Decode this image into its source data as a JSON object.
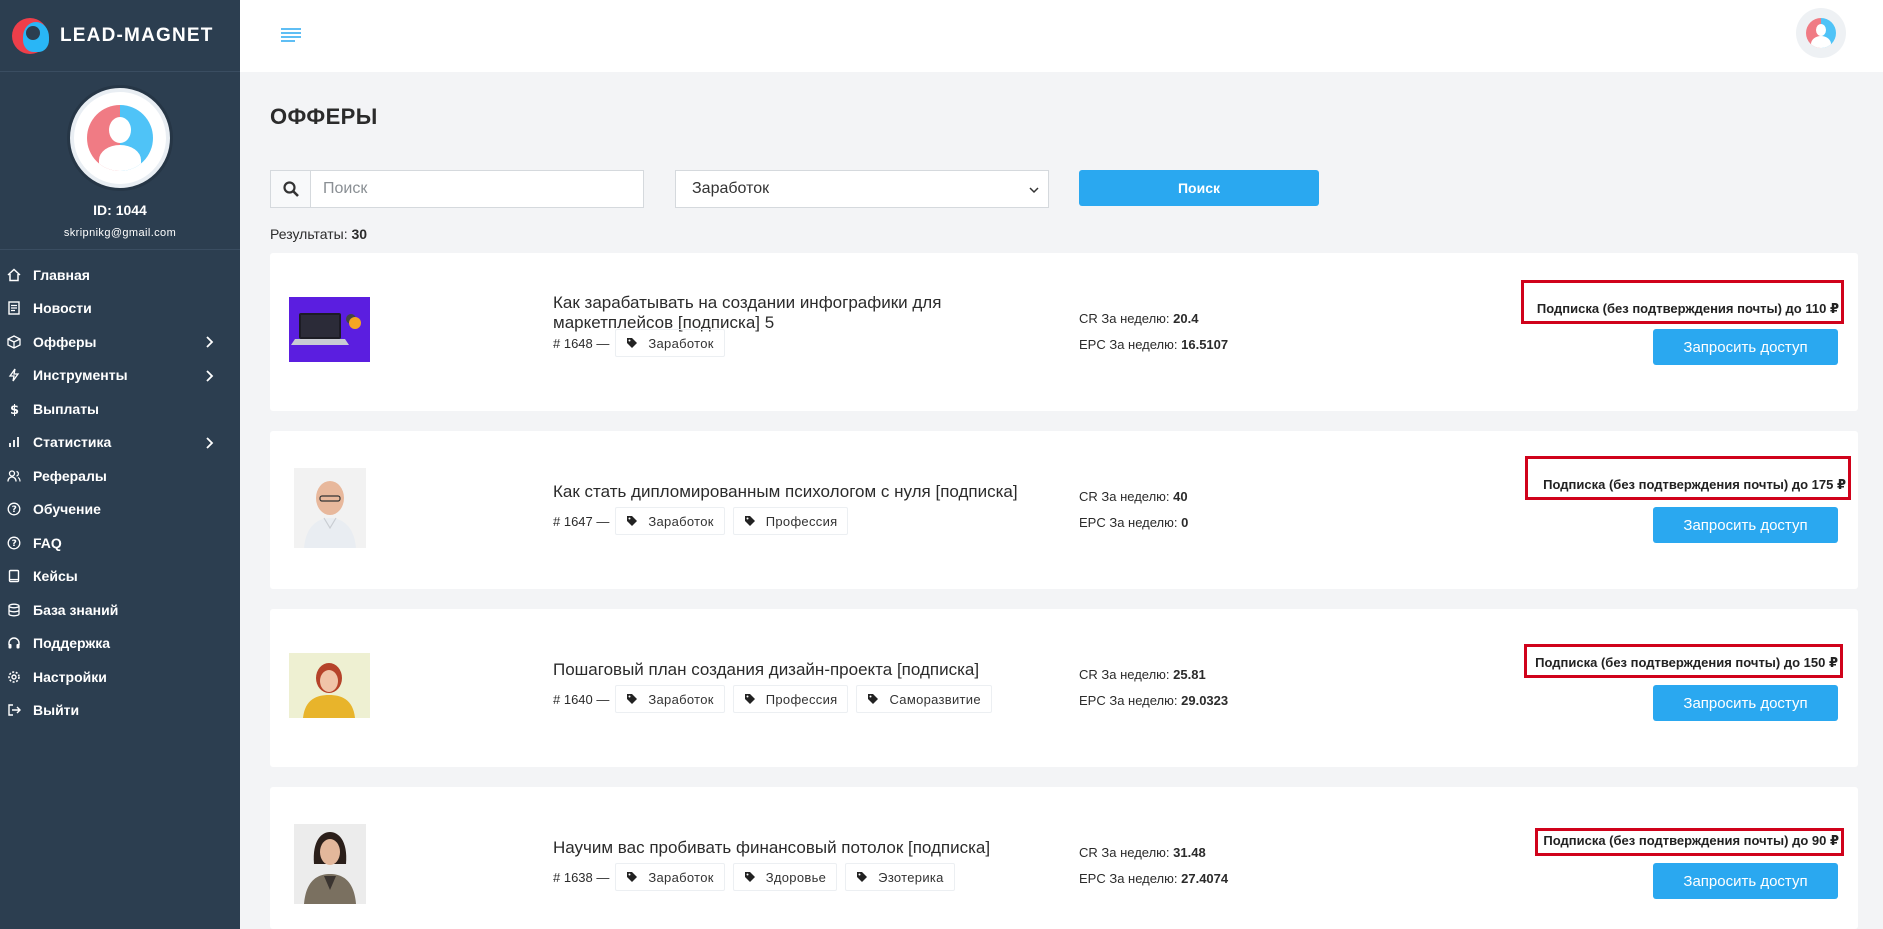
{
  "brand": {
    "name": "LEAD-MAGNET"
  },
  "profile": {
    "id_label": "ID: 1044",
    "email": "skripnikg@gmail.com"
  },
  "sidebar": {
    "items": [
      {
        "label": "Главная",
        "icon": "home-icon"
      },
      {
        "label": "Новости",
        "icon": "newspaper-icon"
      },
      {
        "label": "Офферы",
        "icon": "cube-icon",
        "has_submenu": true
      },
      {
        "label": "Инструменты",
        "icon": "bolt-icon",
        "has_submenu": true
      },
      {
        "label": "Выплаты",
        "icon": "dollar-icon"
      },
      {
        "label": "Статистика",
        "icon": "bar-chart-icon",
        "has_submenu": true
      },
      {
        "label": "Рефералы",
        "icon": "users-icon"
      },
      {
        "label": "Обучение",
        "icon": "question-circle-icon"
      },
      {
        "label": "FAQ",
        "icon": "question-circle-icon"
      },
      {
        "label": "Кейсы",
        "icon": "book-icon"
      },
      {
        "label": "База знаний",
        "icon": "database-icon"
      },
      {
        "label": "Поддержка",
        "icon": "headphones-icon"
      },
      {
        "label": "Настройки",
        "icon": "gear-icon"
      },
      {
        "label": "Выйти",
        "icon": "logout-icon"
      }
    ]
  },
  "page": {
    "title": "ОФФЕРЫ"
  },
  "search": {
    "placeholder": "Поиск",
    "value": ""
  },
  "filter": {
    "selected": "Заработок"
  },
  "search_button": "Поиск",
  "results": {
    "label": "Результаты:",
    "count": "30"
  },
  "offers": [
    {
      "title": "Как зарабатывать на создании инфографики для маркетплейсов [подписка] 5",
      "number": "# 1648 —",
      "tags": [
        "Заработок"
      ],
      "cr_label": "CR За неделю:",
      "cr": "20.4",
      "epc_label": "EPC За неделю:",
      "epc": "16.5107",
      "payout": "Подписка (без подтверждения почты) до 110 ₽",
      "button": "Запросить доступ"
    },
    {
      "title": "Как стать дипломированным психологом с нуля [подписка]",
      "number": "# 1647 —",
      "tags": [
        "Заработок",
        "Профессия"
      ],
      "cr_label": "CR За неделю:",
      "cr": "40",
      "epc_label": "EPC За неделю:",
      "epc": "0",
      "payout": "Подписка (без подтверждения почты) до 175 ₽",
      "button": "Запросить доступ"
    },
    {
      "title": "Пошаговый план создания дизайн-проекта [подписка]",
      "number": "# 1640 —",
      "tags": [
        "Заработок",
        "Профессия",
        "Саморазвитие"
      ],
      "cr_label": "CR За неделю:",
      "cr": "25.81",
      "epc_label": "EPC За неделю:",
      "epc": "29.0323",
      "payout": "Подписка (без подтверждения почты) до 150 ₽",
      "button": "Запросить доступ"
    },
    {
      "title": "Научим вас пробивать финансовый потолок [подписка]",
      "number": "# 1638 —",
      "tags": [
        "Заработок",
        "Здоровье",
        "Эзотерика"
      ],
      "cr_label": "CR За неделю:",
      "cr": "31.48",
      "epc_label": "EPC За неделю:",
      "epc": "27.4074",
      "payout": "Подписка (без подтверждения почты) до 90 ₽",
      "button": "Запросить доступ"
    }
  ],
  "colors": {
    "sidebar_bg": "#2c3e50",
    "accent": "#2aa8f0",
    "highlight_border": "#d0021b"
  }
}
